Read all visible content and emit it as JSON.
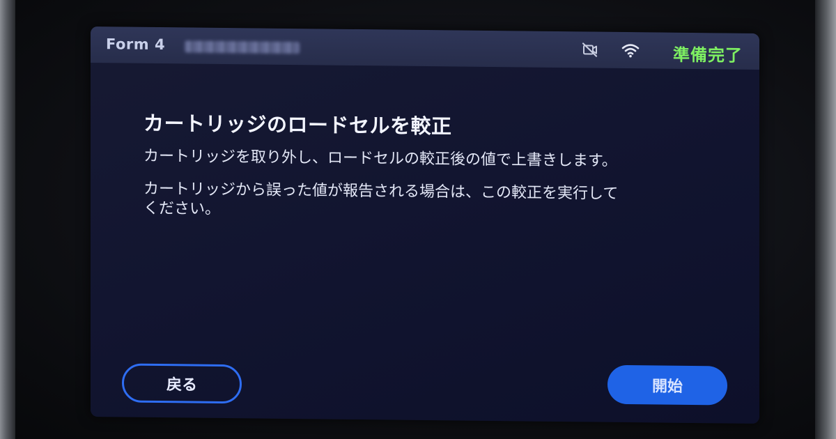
{
  "status_bar": {
    "model": "Form 4",
    "printer_name_icon": "blurred-printer-name",
    "camera_icon": "camera-off-icon",
    "wifi_icon": "wifi-icon",
    "status": "準備完了",
    "status_color": "#7ef062"
  },
  "dialog": {
    "title": "カートリッジのロードセルを較正",
    "paragraphs": [
      "カートリッジを取り外し、ロードセルの較正後の値で上書きします。",
      "カートリッジから誤った値が報告される場合は、この較正を実行してください。"
    ]
  },
  "buttons": {
    "back_label": "戻る",
    "start_label": "開始",
    "accent_color": "#1f63e6"
  }
}
